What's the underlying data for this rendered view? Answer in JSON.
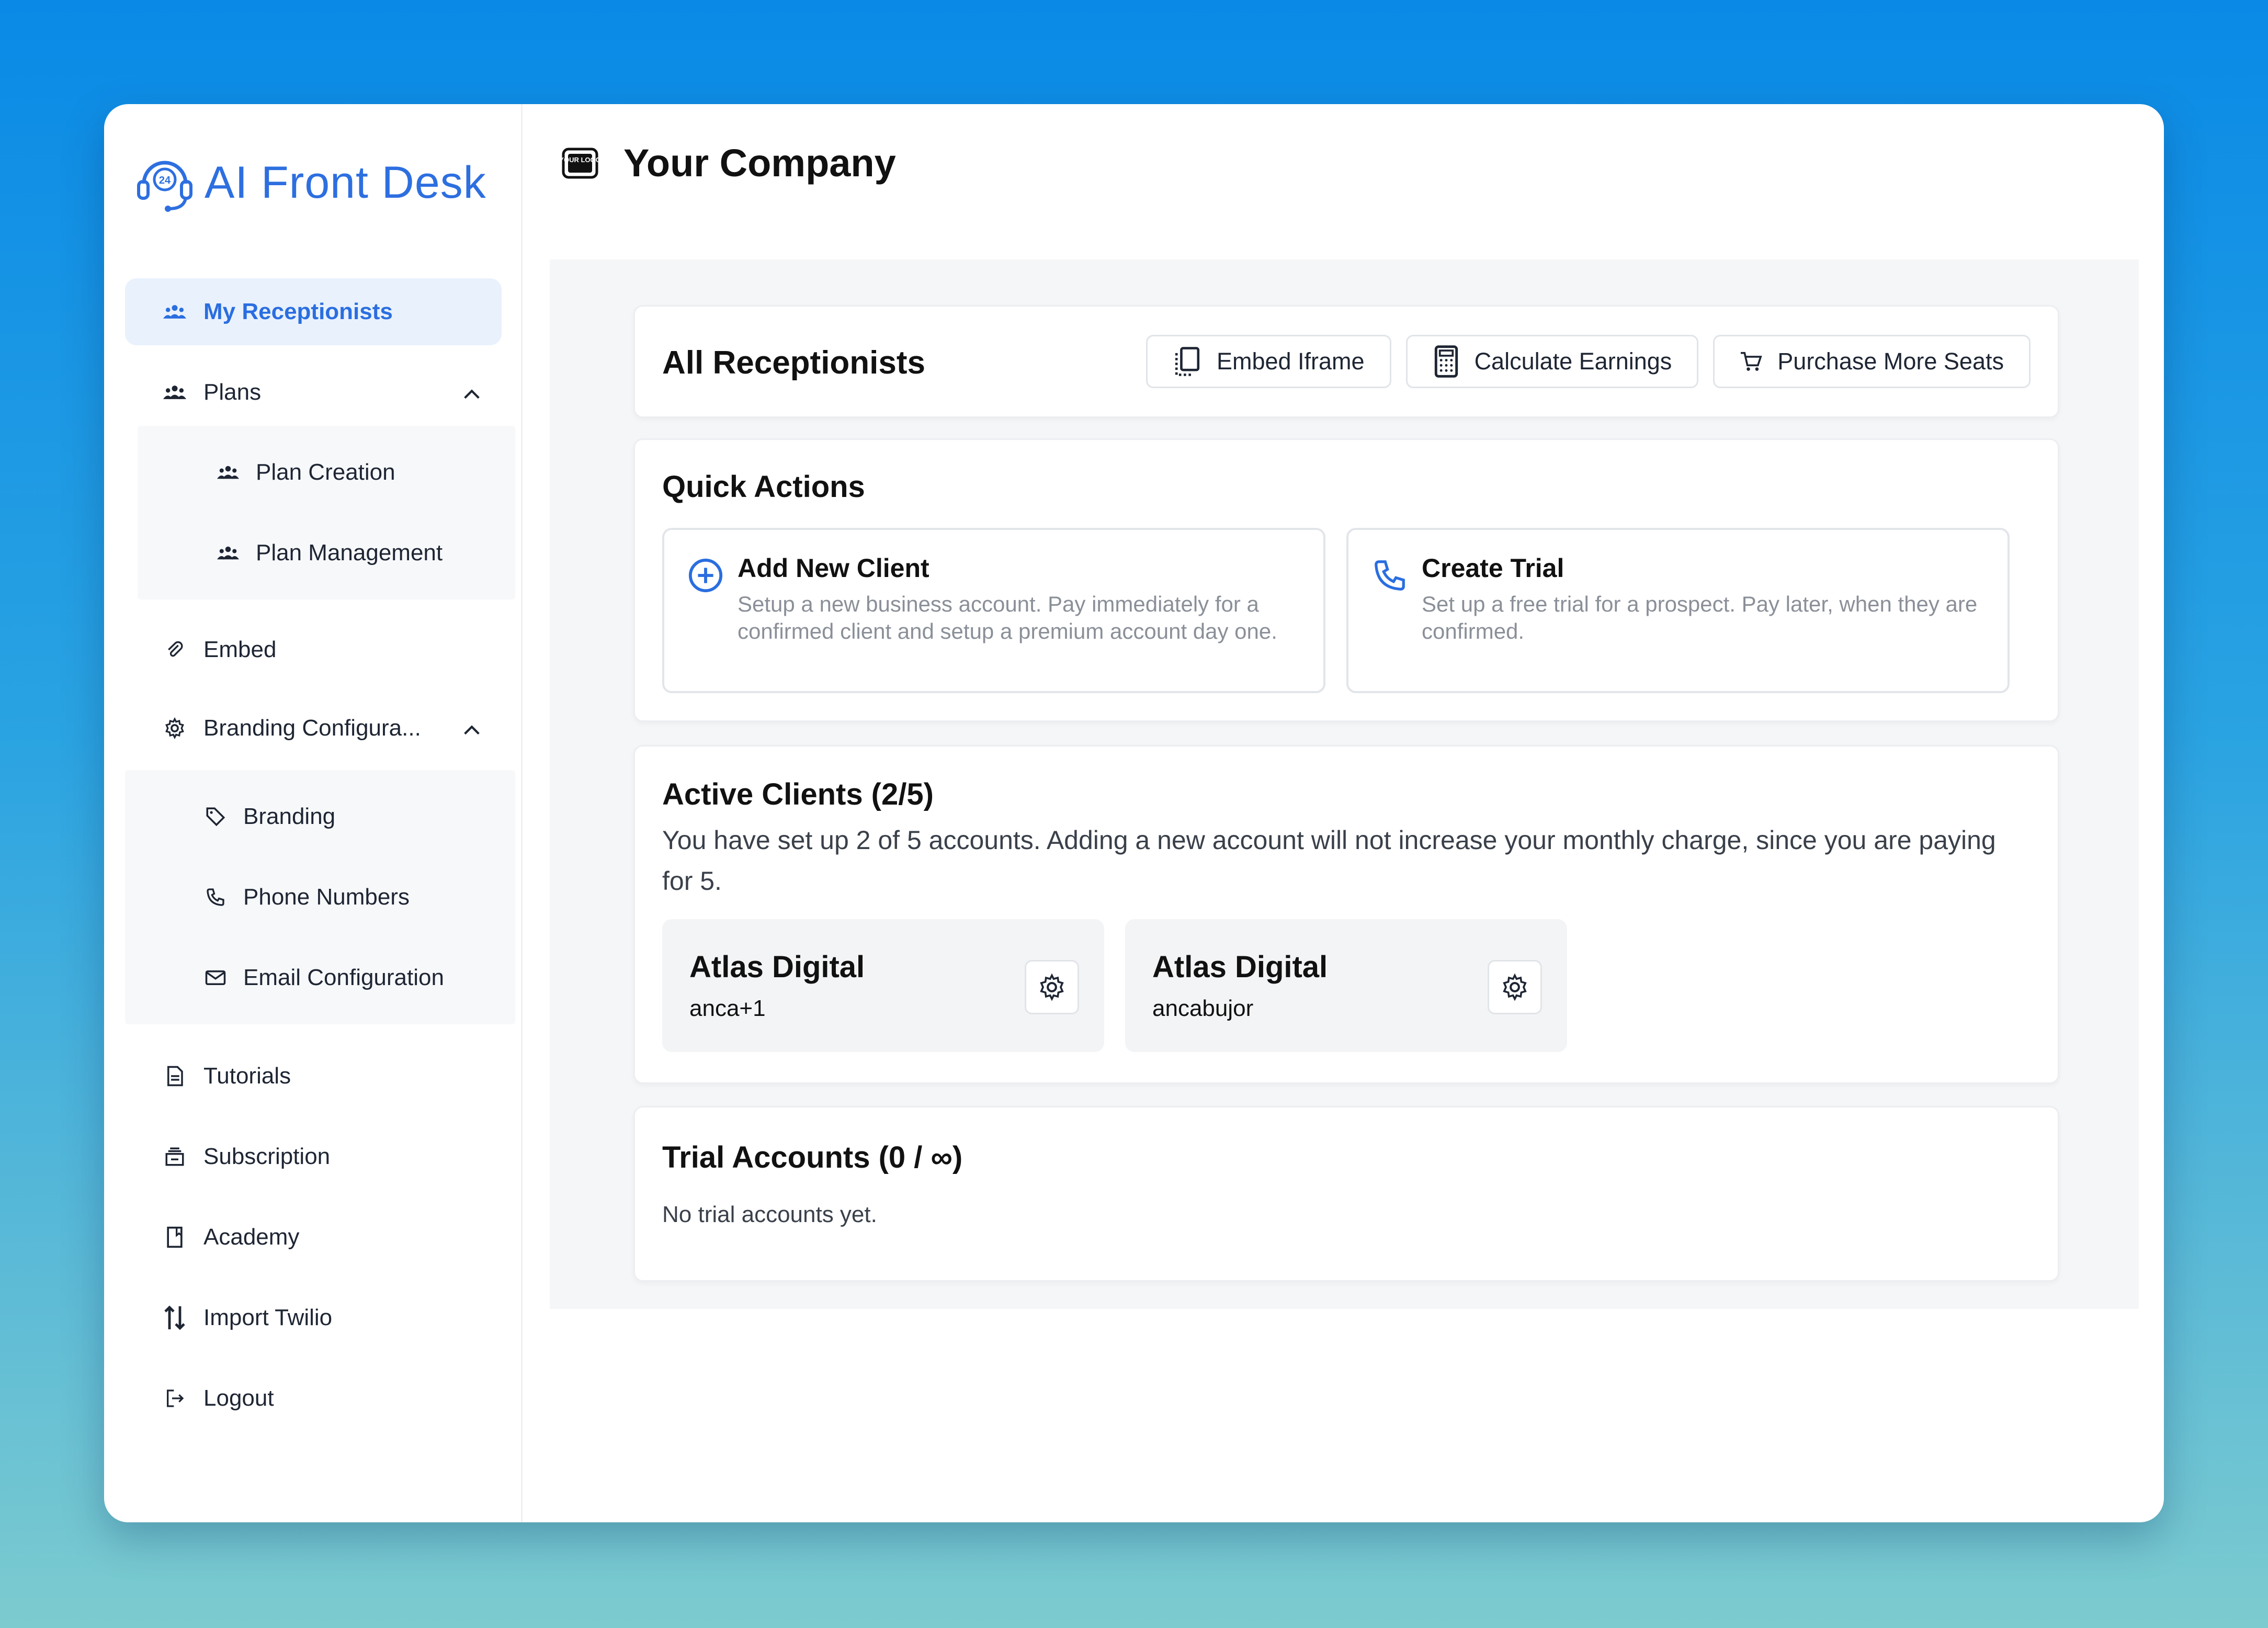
{
  "brand": {
    "name": "AI Front Desk",
    "accent": "#2d6fe0"
  },
  "sidebar": {
    "items": [
      {
        "label": "My Receptionists",
        "icon": "users-icon",
        "active": true
      },
      {
        "label": "Plans",
        "icon": "users-icon",
        "expanded": true,
        "children": [
          {
            "label": "Plan Creation",
            "icon": "users-icon"
          },
          {
            "label": "Plan Management",
            "icon": "users-icon"
          }
        ]
      },
      {
        "label": "Embed",
        "icon": "paperclip-icon"
      },
      {
        "label": "Branding Configura...",
        "icon": "gear-icon",
        "expanded": true,
        "children": [
          {
            "label": "Branding",
            "icon": "tag-icon"
          },
          {
            "label": "Phone Numbers",
            "icon": "phone-icon"
          },
          {
            "label": "Email Configuration",
            "icon": "mail-icon"
          }
        ]
      },
      {
        "label": "Tutorials",
        "icon": "document-icon"
      },
      {
        "label": "Subscription",
        "icon": "subscription-icon"
      },
      {
        "label": "Academy",
        "icon": "book-icon"
      },
      {
        "label": "Import Twilio",
        "icon": "arrows-updown-icon"
      },
      {
        "label": "Logout",
        "icon": "logout-icon"
      }
    ]
  },
  "header": {
    "logo_text": "YOUR LOGO",
    "company": "Your Company"
  },
  "receptionists": {
    "title": "All Receptionists",
    "buttons": {
      "embed": "Embed Iframe",
      "earnings": "Calculate Earnings",
      "seats": "Purchase More Seats"
    }
  },
  "quick_actions": {
    "title": "Quick Actions",
    "add_client": {
      "title": "Add New Client",
      "desc": "Setup a new business account. Pay immediately for a confirmed client and setup a premium account day one."
    },
    "create_trial": {
      "title": "Create Trial",
      "desc": "Set up a free trial for a prospect. Pay later, when they are confirmed."
    }
  },
  "active_clients": {
    "title": "Active Clients (2/5)",
    "desc": "You have set up 2 of 5 accounts. Adding a new account will not increase your monthly charge, since you are paying for 5.",
    "clients": [
      {
        "name": "Atlas Digital",
        "user": "anca+1"
      },
      {
        "name": "Atlas Digital",
        "user": "ancabujor"
      }
    ]
  },
  "trial_accounts": {
    "title": "Trial Accounts (0 / ∞)",
    "empty": "No trial accounts yet."
  }
}
